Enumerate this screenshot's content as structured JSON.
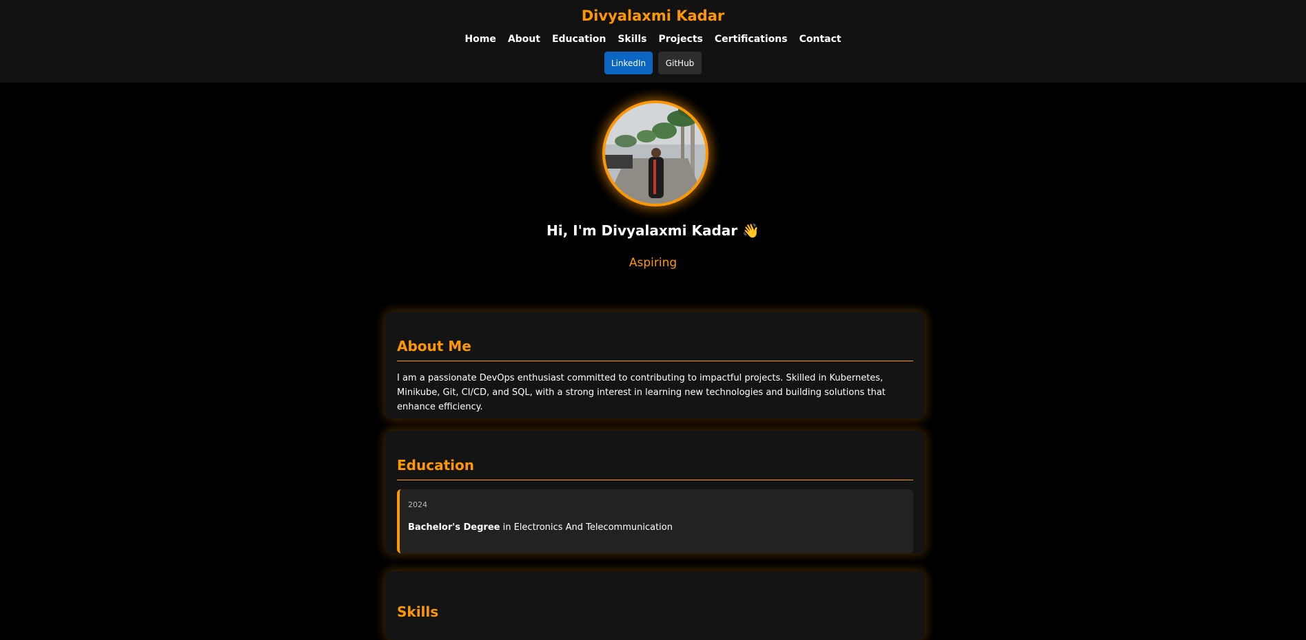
{
  "header": {
    "brand": "Divyalaxmi Kadar",
    "nav": [
      "Home",
      "About",
      "Education",
      "Skills",
      "Projects",
      "Certifications",
      "Contact"
    ],
    "linkedin_label": "LinkedIn",
    "github_label": "GitHub"
  },
  "hero": {
    "title": "Hi, I'm Divyalaxmi Kadar 👋",
    "subtitle": "Aspiring"
  },
  "about": {
    "heading": "About Me",
    "text": "I am a passionate DevOps enthusiast committed to contributing to impactful projects. Skilled in Kubernetes, Minikube, Git, CI/CD, and SQL, with a strong interest in learning new technologies and building solutions that enhance efficiency."
  },
  "education": {
    "heading": "Education",
    "items": [
      {
        "year": "2024",
        "degree": "Bachelor's Degree",
        "connector": " in ",
        "field": "Electronics And Telecommunication"
      }
    ]
  },
  "skills": {
    "heading": "Skills"
  },
  "colors": {
    "accent": "#ff9800",
    "linkedin": "#0a66c2",
    "github": "#2d2d2d",
    "background": "#000000",
    "card": "#141414"
  }
}
